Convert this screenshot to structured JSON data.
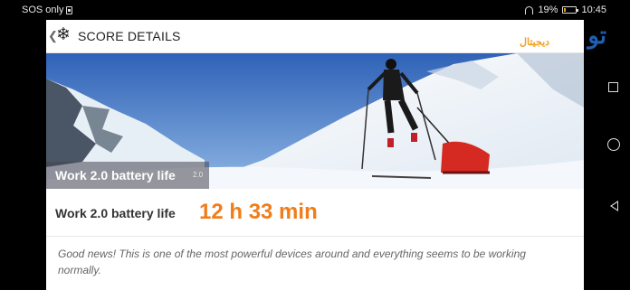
{
  "status_bar": {
    "carrier": "SOS only",
    "battery_percent": "19%",
    "battery_level": 0.19,
    "time": "10:45",
    "icons": [
      "sim-icon",
      "headphone-icon",
      "battery-icon"
    ]
  },
  "app_bar": {
    "back_icon": "chevron-left-icon",
    "icon": "snowflake-icon",
    "title": "SCORE DETAILS"
  },
  "hero": {
    "title": "Work 2.0 battery life",
    "version": "2.0"
  },
  "result": {
    "label": "Work 2.0 battery life",
    "value": "12 h 33 min",
    "value_color": "#f07d1a"
  },
  "message": "Good news! This is one of the most powerful devices around and everything seems to be working normally.",
  "watermark": {
    "text": "Digiato",
    "sub": "دیجیاتو"
  },
  "nav_bar": {
    "buttons": [
      "recents-icon",
      "home-icon",
      "back-icon"
    ]
  }
}
